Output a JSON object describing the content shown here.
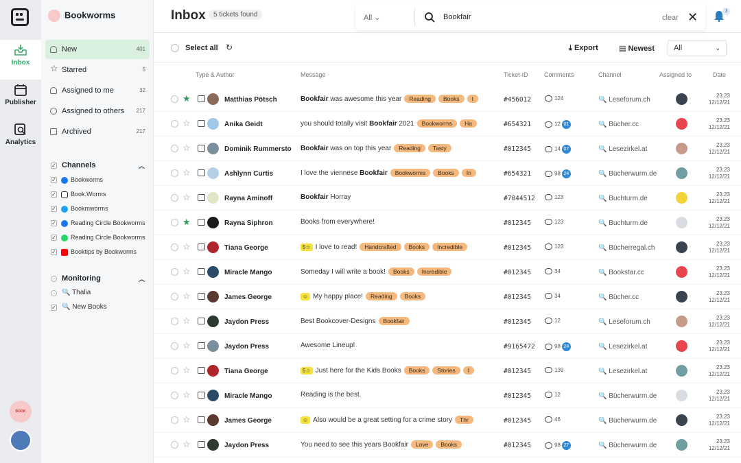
{
  "rail": {
    "items": [
      {
        "label": "Inbox",
        "icon": "inbox-icon"
      },
      {
        "label": "Publisher",
        "icon": "calendar-icon"
      },
      {
        "label": "Analytics",
        "icon": "analytics-icon"
      }
    ],
    "bottom_logo_text": "BOOK FOREST"
  },
  "sidebar": {
    "brand": "Bookworms",
    "nav": [
      {
        "label": "New",
        "count": "401",
        "icon": "bell-icon"
      },
      {
        "label": "Starred",
        "count": "6",
        "icon": "star-icon"
      },
      {
        "label": "Assigned to me",
        "count": "32",
        "icon": "person-icon"
      },
      {
        "label": "Assigned to others",
        "count": "217",
        "icon": "people-icon"
      },
      {
        "label": "Archived",
        "count": "217",
        "icon": "archive-icon"
      }
    ],
    "channels_title": "Channels",
    "channels": [
      {
        "label": "Bookworms",
        "icon": "facebook-icon",
        "color": "#1877f2"
      },
      {
        "label": "Book.Worms",
        "icon": "instagram-icon",
        "color": "#222222"
      },
      {
        "label": "Bookmworms",
        "icon": "twitter-icon",
        "color": "#1da1f2"
      },
      {
        "label": "Reading Circle Bookworms",
        "icon": "facebook-icon",
        "color": "#1877f2"
      },
      {
        "label": "Reading Circle Bookworms",
        "icon": "whatsapp-icon",
        "color": "#25d366"
      },
      {
        "label": "Booktips by Bookworms",
        "icon": "youtube-icon",
        "color": "#ff0000"
      }
    ],
    "monitoring_title": "Monitoring",
    "monitoring": [
      {
        "label": "Thalia",
        "checked": false
      },
      {
        "label": "New Books",
        "checked": true
      }
    ]
  },
  "header": {
    "title": "Inbox",
    "found": "5 tickets found",
    "filter": "All",
    "query": "Bookfair",
    "clear": "clear",
    "notifications": "3"
  },
  "toolbar": {
    "select_all": "Select all",
    "export": "Export",
    "sort": "Newest",
    "view": "All"
  },
  "columns": [
    "Type & Author",
    "Message",
    "Ticket-ID",
    "Comments",
    "Channel",
    "Assigned to",
    "Date"
  ],
  "rows": [
    {
      "starred": true,
      "author": "Matthias Pötsch",
      "pre": "",
      "bold": "Bookfair",
      "text": " was awesome this year",
      "tags": [
        "Reading",
        "Books",
        "I"
      ],
      "tid": "#456012",
      "comments": "124",
      "badge": "",
      "channel": "Leseforum.ch",
      "time": "23:23",
      "date": "12/12/21",
      "ava": "#8c6a5a",
      "asg": "#3a4350"
    },
    {
      "starred": false,
      "author": "Anika Geidt",
      "pre": "you should totally visit ",
      "bold": "Bookfair",
      "text": " 2021",
      "tags": [
        "Bookworms",
        "Ha"
      ],
      "tid": "#654321",
      "comments": "12",
      "badge": "01",
      "channel": "Bücher.cc",
      "time": "23:23",
      "date": "12/12/21",
      "ava": "#9fc7e8",
      "asg": "#e9454c"
    },
    {
      "starred": false,
      "author": "Dominik Rummersto",
      "pre": "",
      "bold": "Bookfair",
      "text": " was on top this year",
      "tags": [
        "Reading",
        "Tasty"
      ],
      "tid": "#012345",
      "comments": "14",
      "badge": "07",
      "channel": "Lesezirkel.at",
      "time": "23:23",
      "date": "12/12/21",
      "ava": "#7a8f9c",
      "asg": "#c79a8a"
    },
    {
      "starred": false,
      "author": "Ashlynn Curtis",
      "pre": "I love the viennese ",
      "bold": "Bookfair",
      "text": "",
      "tags": [
        "Bookworms",
        "Books",
        "In"
      ],
      "tid": "#654321",
      "comments": "98",
      "badge": "24",
      "channel": "Bücherwurm.de",
      "time": "23:23",
      "date": "12/12/21",
      "ava": "#b4cfe6",
      "asg": "#6f9fa0"
    },
    {
      "starred": false,
      "author": "Rayna Aminoff",
      "pre": "",
      "bold": "Bookfair",
      "text": " Horray",
      "tags": [],
      "tid": "#7844512",
      "comments": "123",
      "badge": "",
      "channel": "Buchturm.de",
      "time": "23:23",
      "date": "12/12/21",
      "ava": "#dfe7c8",
      "asg": "#f2d33a"
    },
    {
      "starred": true,
      "author": "Rayna Siphron",
      "pre": "Books from everywhere!",
      "bold": "",
      "text": "",
      "tags": [],
      "tid": "#012345",
      "comments": "123",
      "badge": "",
      "channel": "Buchturm.de",
      "time": "23:23",
      "date": "12/12/21",
      "ava": "#1c1c1c",
      "asg": "#d9dde2"
    },
    {
      "starred": false,
      "author": "Tiana George",
      "rating": "5☆",
      "pre": "I love to read!",
      "bold": "",
      "text": "",
      "tags": [
        "Handcrafted",
        "Books",
        "Incredible"
      ],
      "tid": "#012345",
      "comments": "123",
      "badge": "",
      "channel": "Bücherregal.ch",
      "time": "23:23",
      "date": "12/12/21",
      "ava": "#b0242b",
      "asg": "#3a4350"
    },
    {
      "starred": false,
      "author": "Miracle Mango",
      "pre": "Someday I will write a book!",
      "bold": "",
      "text": "",
      "tags": [
        "Books",
        "Incredible"
      ],
      "tid": "#012345",
      "comments": "34",
      "badge": "",
      "channel": "Bookstar.cc",
      "time": "23:23",
      "date": "12/12/21",
      "ava": "#2b4a66",
      "asg": "#e9454c"
    },
    {
      "starred": false,
      "author": "James George",
      "rating": "☺",
      "pre": "My happy place!",
      "bold": "",
      "text": "",
      "tags": [
        "Reading",
        "Books"
      ],
      "tid": "#012345",
      "comments": "34",
      "badge": "",
      "channel": "Bücher.cc",
      "time": "23:23",
      "date": "12/12/21",
      "ava": "#5a3a30",
      "asg": "#3a4350"
    },
    {
      "starred": false,
      "author": "Jaydon Press",
      "pre": "Best Bookcover-Designs",
      "bold": "",
      "text": "",
      "tags": [
        "Bookfair"
      ],
      "tid": "#012345",
      "comments": "12",
      "badge": "",
      "channel": "Leseforum.ch",
      "time": "23:23",
      "date": "12/12/21",
      "ava": "#2d3a2f",
      "asg": "#c79a8a"
    },
    {
      "starred": false,
      "author": "Jaydon Press",
      "pre": "Awesome Lineup!",
      "bold": "",
      "text": "",
      "tags": [],
      "tid": "#9165472",
      "comments": "98",
      "badge": "24",
      "channel": "Lesezirkel.at",
      "time": "23:23",
      "date": "12/12/21",
      "ava": "#7a8f9c",
      "asg": "#e9454c"
    },
    {
      "starred": false,
      "author": "Tiana George",
      "rating": "5☆",
      "pre": "Just here for the Kids Books",
      "bold": "",
      "text": "",
      "tags": [
        "Books",
        "Stories",
        "I"
      ],
      "tid": "#012345",
      "comments": "139",
      "badge": "",
      "channel": "Lesezirkel.at",
      "time": "23:23",
      "date": "12/12/21",
      "ava": "#b0242b",
      "asg": "#6f9fa0"
    },
    {
      "starred": false,
      "author": "Miracle Mango",
      "pre": "Reading is the best.",
      "bold": "",
      "text": "",
      "tags": [],
      "tid": "#012345",
      "comments": "12",
      "badge": "",
      "channel": "Bücherwurm.de",
      "time": "23:23",
      "date": "12/12/21",
      "ava": "#2b4a66",
      "asg": "#d9dde2"
    },
    {
      "starred": false,
      "author": "James George",
      "rating": "☺",
      "pre": "Also would be a great setting for a crime story",
      "bold": "",
      "text": "",
      "tags": [
        "Thr"
      ],
      "tid": "#012345",
      "comments": "46",
      "badge": "",
      "channel": "Bücherwurm.de",
      "time": "23:23",
      "date": "12/12/21",
      "ava": "#5a3a30",
      "asg": "#3a4350"
    },
    {
      "starred": false,
      "author": "Jaydon Press",
      "pre": "You need to see this years Bookfair",
      "bold": "",
      "text": "",
      "tags": [
        "Love",
        "Books"
      ],
      "tid": "#012345",
      "comments": "98",
      "badge": "27",
      "channel": "Bücherwurm.de",
      "time": "23:23",
      "date": "12/12/21",
      "ava": "#2d3a2f",
      "asg": "#6f9fa0"
    }
  ]
}
